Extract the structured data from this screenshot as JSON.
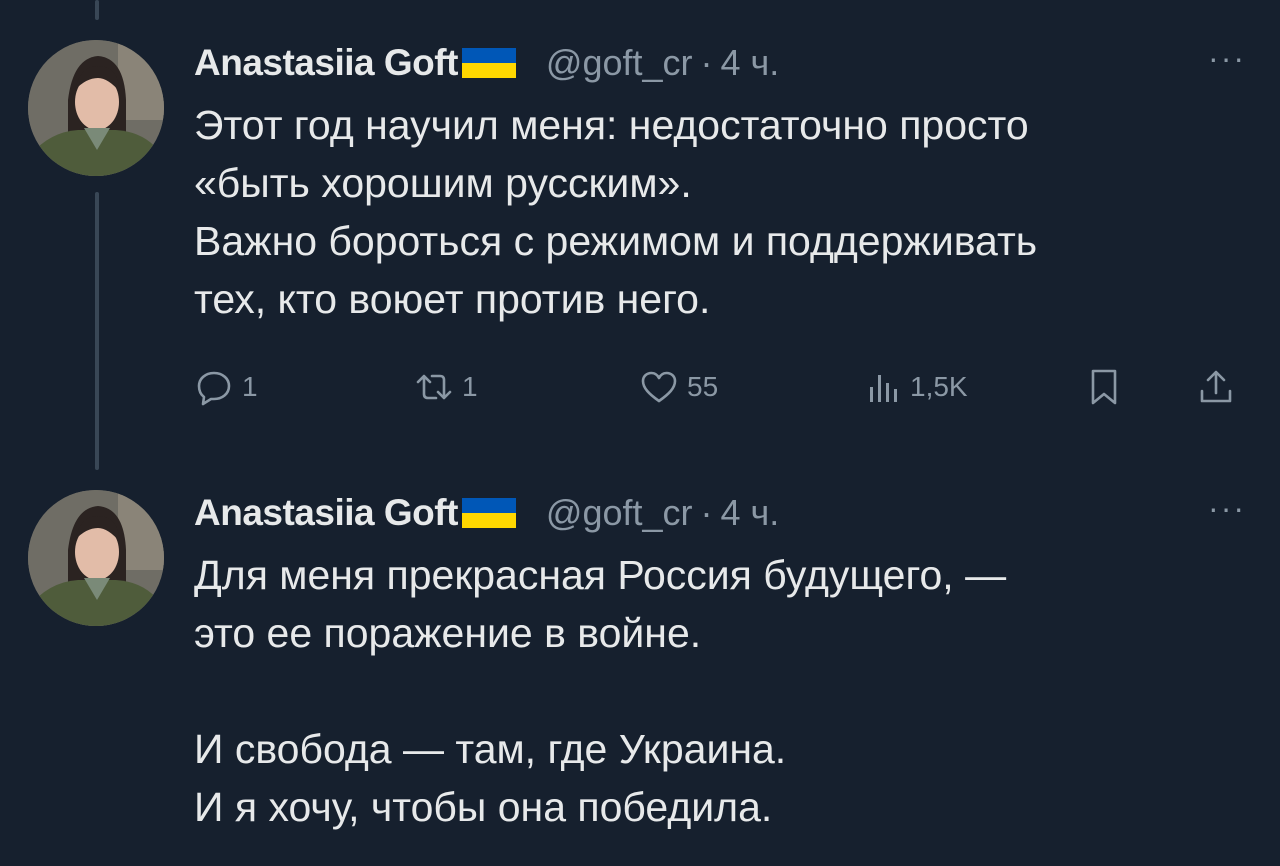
{
  "tweets": [
    {
      "author_name": "Anastasiia Goft",
      "author_flag": "ukraine-flag",
      "handle": "@goft_cr",
      "separator": "·",
      "time": "4 ч.",
      "more": "···",
      "lines": [
        "Этот год научил меня: недостаточно просто",
        "«быть хорошим русским».",
        "Важно бороться с режимом и поддерживать",
        "тех, кто воюет против него."
      ],
      "actions": {
        "reply_count": "1",
        "retweet_count": "1",
        "like_count": "55",
        "views_count": "1,5K"
      }
    },
    {
      "author_name": "Anastasiia Goft",
      "author_flag": "ukraine-flag",
      "handle": "@goft_cr",
      "separator": "·",
      "time": "4 ч.",
      "more": "···",
      "lines": [
        "Для меня прекрасная Россия будущего, —",
        "это ее поражение в войне.",
        "",
        "И свобода — там, где Украина.",
        "И я хочу, чтобы она победила."
      ]
    }
  ],
  "colors": {
    "background": "#16202e",
    "text": "#e7e9ea",
    "muted": "#8b98a5",
    "thread_line": "#394756",
    "flag_blue": "#0057b7",
    "flag_yellow": "#ffd700"
  }
}
